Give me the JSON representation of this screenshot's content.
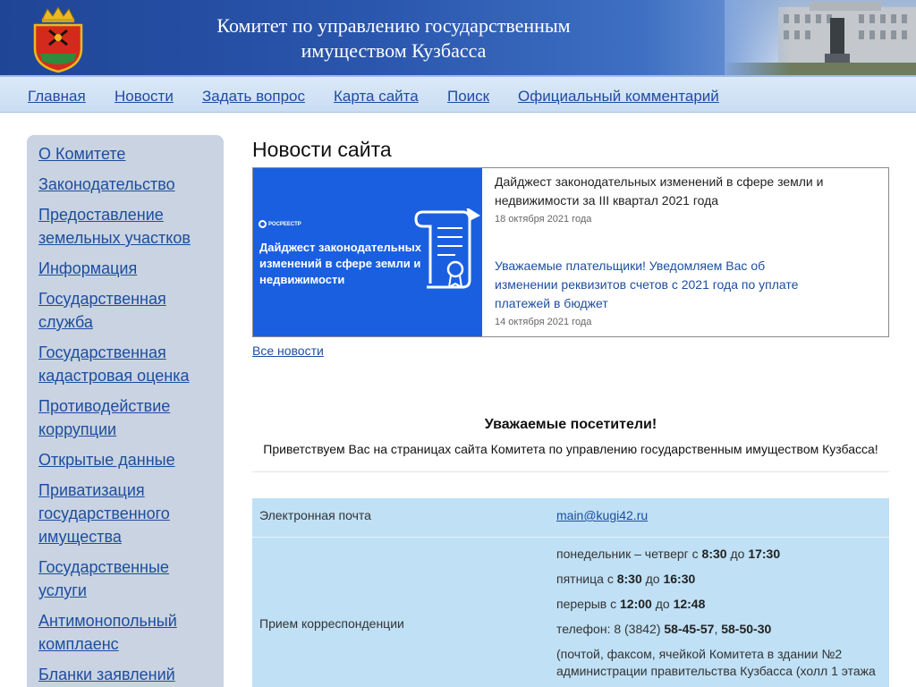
{
  "header": {
    "title_line1": "Комитет по управлению государственным",
    "title_line2": "имуществом Кузбасса"
  },
  "nav": [
    "Главная",
    "Новости",
    "Задать вопрос",
    "Карта сайта",
    "Поиск",
    "Официальный комментарий"
  ],
  "sidebar": [
    "О Комитете",
    "Законодательство",
    "Предоставление земельных участков",
    "Информация",
    "Государственная служба",
    "Государственная кадастровая оценка",
    "Противодействие коррупции",
    "Открытые данные",
    "Приватизация государственного имущества",
    "Государственные услуги",
    "Антимонопольный комплаенс",
    "Бланки заявлений"
  ],
  "main": {
    "title": "Новости сайта",
    "image": {
      "logo_text": "РОСРЕЕСТР",
      "text": "Дайджест законодательных изменений в сфере земли и недвижимости"
    },
    "news": [
      {
        "title": "Дайджест законодательных изменений в сфере земли и недвижимости за III квартал 2021 года",
        "date": "18 октября 2021 года"
      },
      {
        "title": "Уважаемые плательщики! Уведомляем Вас об изменении реквизитов счетов с 2021 года по уплате платежей в бюджет",
        "date": "14 октября 2021 года"
      }
    ],
    "all_news": "Все новости",
    "welcome_title": "Уважаемые посетители!",
    "welcome_text": "Приветствуем Вас на страницах сайта Комитета по управлению государственным имуществом Кузбасса!"
  },
  "contacts": {
    "email_label": "Электронная почта",
    "email_value": "main@kugi42.ru",
    "mail_label": "Прием корреспонденции",
    "schedule": {
      "l1_pre": "понедельник – четверг с ",
      "l1_a": "8:30",
      "l1_mid": " до ",
      "l1_b": "17:30",
      "l2_pre": "пятница с ",
      "l2_a": "8:30",
      "l2_mid": " до ",
      "l2_b": "16:30",
      "l3_pre": "перерыв с ",
      "l3_a": "12:00",
      "l3_mid": " до ",
      "l3_b": "12:48",
      "l4_pre": "телефон: 8 (3842) ",
      "l4_a": "58-45-57",
      "l4_mid": ", ",
      "l4_b": "58-50-30",
      "note": "(почтой, факсом, ячейкой Комитета в здании №2 администрации правительства Кузбасса (холл 1 этажа"
    }
  },
  "colors": {
    "header": "#2a56ad",
    "link": "#1d4d9e",
    "sidebar": "#c9d3e1",
    "news_image": "#1a5fe0",
    "table": "#bfe0f5"
  }
}
